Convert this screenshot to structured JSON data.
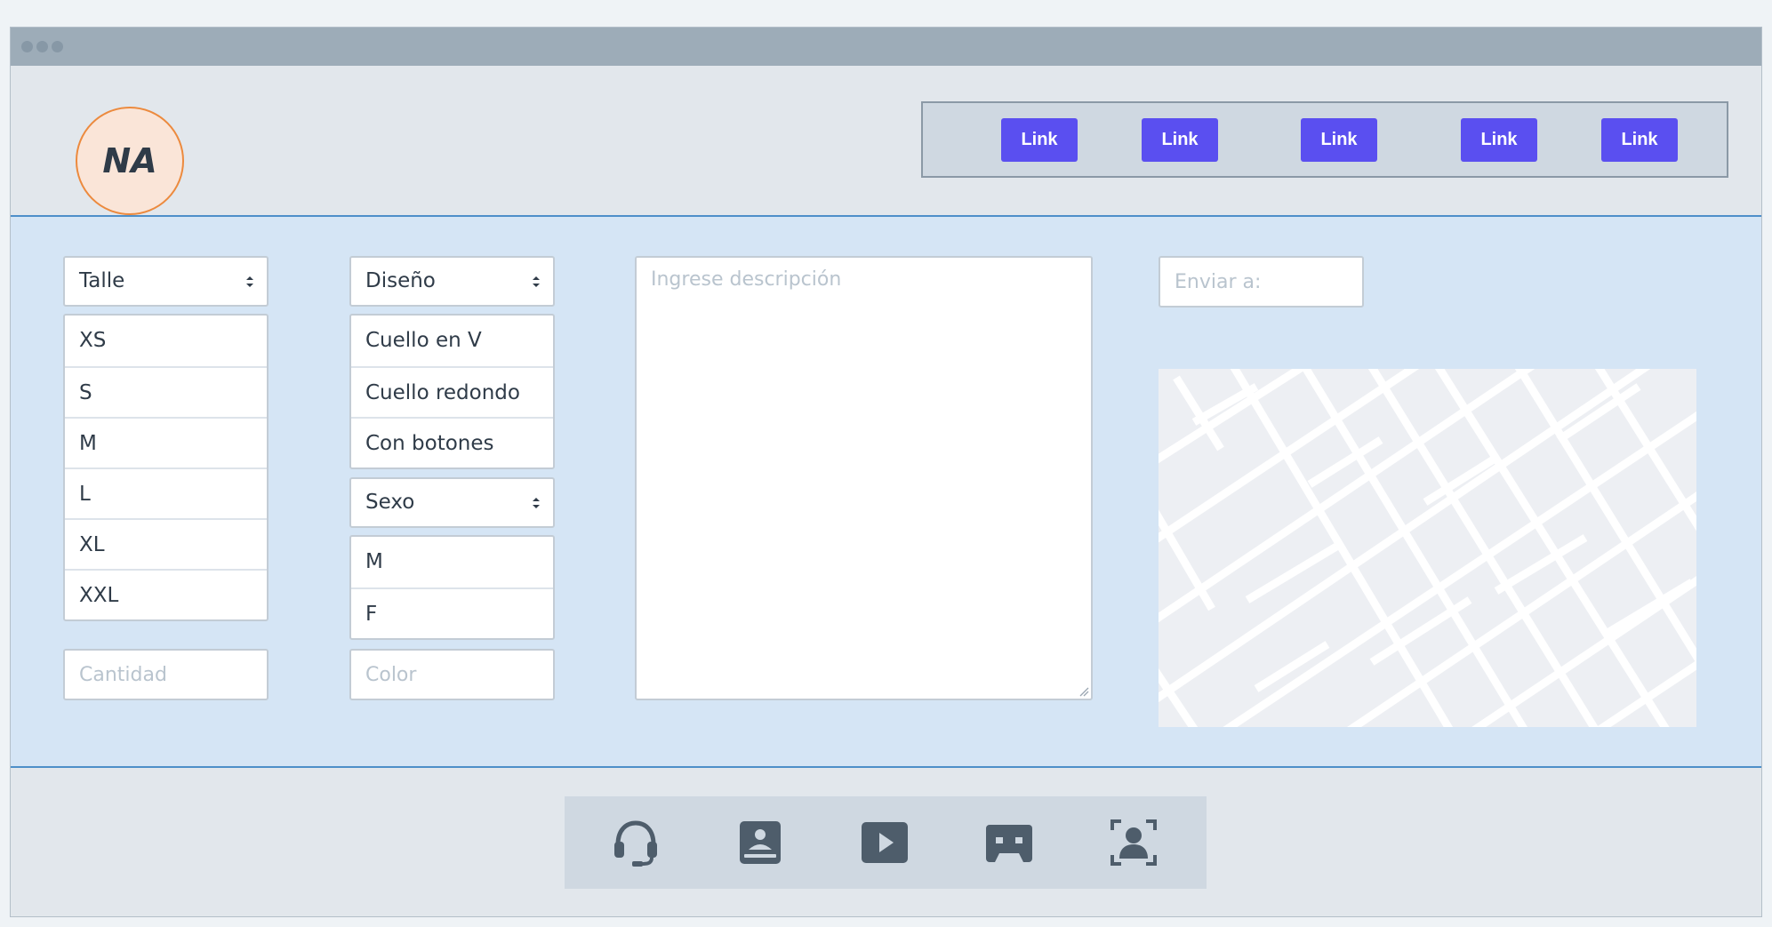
{
  "logo": {
    "text": "NA"
  },
  "nav": {
    "links": [
      "Link",
      "Link",
      "Link",
      "Link",
      "Link"
    ]
  },
  "form": {
    "talle": {
      "label": "Talle",
      "options": [
        "XS",
        "S",
        "M",
        "L",
        "XL",
        "XXL"
      ]
    },
    "diseno": {
      "label": "Diseño",
      "options": [
        "Cuello en V",
        "Cuello redondo",
        "Con botones"
      ]
    },
    "sexo": {
      "label": "Sexo",
      "options": [
        "M",
        "F"
      ]
    },
    "cantidad": {
      "placeholder": "Cantidad"
    },
    "color": {
      "placeholder": "Color"
    },
    "descripcion": {
      "placeholder": "Ingrese descripción"
    },
    "enviar": {
      "placeholder": "Enviar a:"
    }
  },
  "footer": {
    "icons": [
      "headset-icon",
      "webcam-icon",
      "play-video-icon",
      "cassette-icon",
      "face-scan-icon"
    ]
  },
  "colors": {
    "accent": "#5a4ff0",
    "logo_border": "#ec8a3e",
    "logo_fill": "#fae5d8",
    "main_bg": "#d5e5f5",
    "main_border": "#4e8fc9",
    "icon": "#4e5d6b"
  }
}
